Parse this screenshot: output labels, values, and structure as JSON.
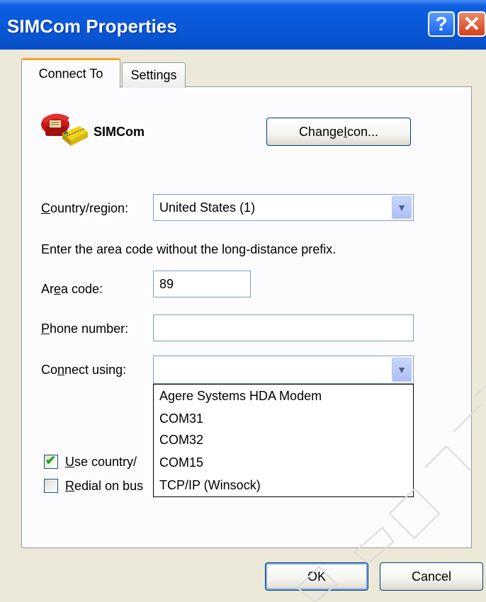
{
  "window": {
    "title": "SIMCom Properties",
    "help_glyph": "?",
    "close_glyph": "✕"
  },
  "tabs": [
    {
      "label": "Connect To",
      "active": true
    },
    {
      "label": "Settings",
      "active": false
    }
  ],
  "connection": {
    "icon": "phone-connection-icon",
    "name": "SIMCom",
    "change_icon_label_pre": "Change ",
    "change_icon_label_u": "I",
    "change_icon_label_post": "con..."
  },
  "country": {
    "label_u": "C",
    "label_rest": "ountry/region:",
    "value": "United States (1)"
  },
  "instructions": "Enter the area code without the long-distance prefix.",
  "area_code": {
    "label_pre": "Ar",
    "label_u": "e",
    "label_post": "a code:",
    "value": "89"
  },
  "phone": {
    "label_u": "P",
    "label_rest": "hone number:",
    "value": ""
  },
  "connect_using": {
    "label_pre": "Co",
    "label_u": "n",
    "label_post": "nect using:",
    "value": "",
    "options": [
      "Agere Systems HDA Modem",
      "COM31",
      "COM32",
      "COM15",
      "TCP/IP (Winsock)"
    ]
  },
  "checkboxes": {
    "use_country": {
      "label_u": "U",
      "label_rest": "se country/",
      "checked": true
    },
    "redial": {
      "label_u": "R",
      "label_rest": "edial on bus",
      "checked": false
    }
  },
  "buttons": {
    "ok": "OK",
    "cancel": "Cancel"
  },
  "colors": {
    "titlebar": "#0a57d8",
    "dialog_bg": "#ece9d8",
    "tab_highlight": "#f2a62a",
    "close_button": "#d5401b"
  }
}
